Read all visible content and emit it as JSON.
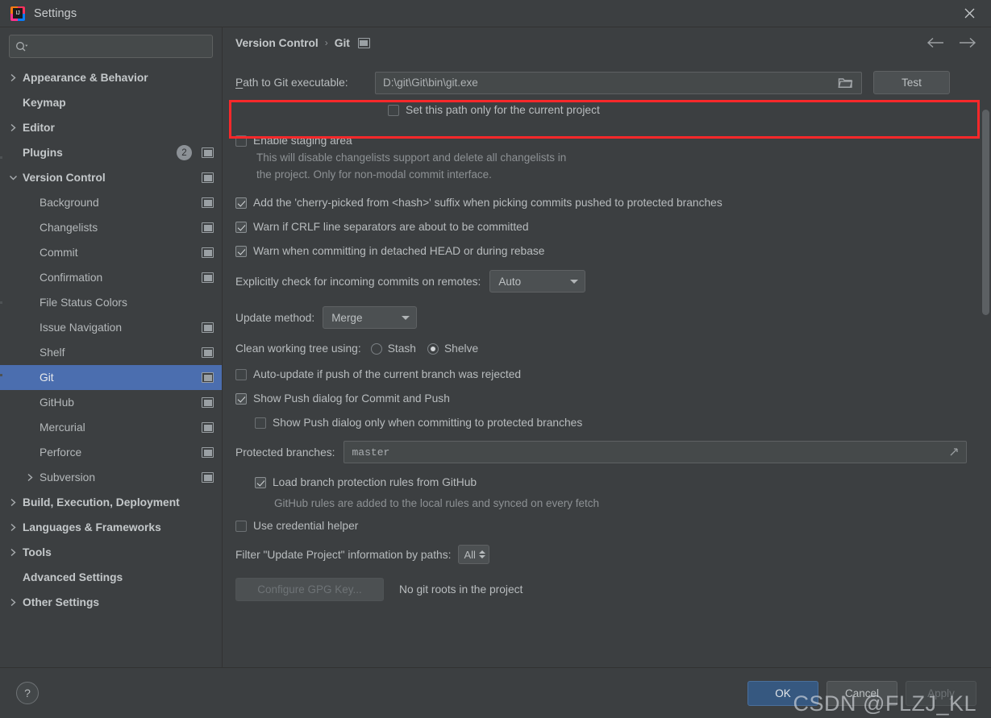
{
  "window": {
    "title": "Settings",
    "app_icon": "intellij-idea-icon",
    "close_icon": "close-icon"
  },
  "sidebar": {
    "search": {
      "placeholder": "",
      "value": "",
      "icon": "search-icon"
    },
    "items": [
      {
        "label": "Appearance & Behavior",
        "level": 0,
        "arrow": "right",
        "bold": true,
        "badge": "",
        "mod": false
      },
      {
        "label": "Keymap",
        "level": 0,
        "arrow": "none",
        "bold": true,
        "badge": "",
        "mod": false
      },
      {
        "label": "Editor",
        "level": 0,
        "arrow": "right",
        "bold": true,
        "badge": "",
        "mod": false
      },
      {
        "label": "Plugins",
        "level": 0,
        "arrow": "none",
        "bold": true,
        "badge": "2",
        "mod": true
      },
      {
        "label": "Version Control",
        "level": 0,
        "arrow": "down",
        "bold": true,
        "badge": "",
        "mod": true
      },
      {
        "label": "Background",
        "level": 1,
        "arrow": "none",
        "bold": false,
        "badge": "",
        "mod": true
      },
      {
        "label": "Changelists",
        "level": 1,
        "arrow": "none",
        "bold": false,
        "badge": "",
        "mod": true
      },
      {
        "label": "Commit",
        "level": 1,
        "arrow": "none",
        "bold": false,
        "badge": "",
        "mod": true
      },
      {
        "label": "Confirmation",
        "level": 1,
        "arrow": "none",
        "bold": false,
        "badge": "",
        "mod": true
      },
      {
        "label": "File Status Colors",
        "level": 1,
        "arrow": "none",
        "bold": false,
        "badge": "",
        "mod": false
      },
      {
        "label": "Issue Navigation",
        "level": 1,
        "arrow": "none",
        "bold": false,
        "badge": "",
        "mod": true
      },
      {
        "label": "Shelf",
        "level": 1,
        "arrow": "none",
        "bold": false,
        "badge": "",
        "mod": true
      },
      {
        "label": "Git",
        "level": 1,
        "arrow": "none",
        "bold": false,
        "badge": "",
        "mod": true,
        "selected": true
      },
      {
        "label": "GitHub",
        "level": 1,
        "arrow": "none",
        "bold": false,
        "badge": "",
        "mod": true
      },
      {
        "label": "Mercurial",
        "level": 1,
        "arrow": "none",
        "bold": false,
        "badge": "",
        "mod": true
      },
      {
        "label": "Perforce",
        "level": 1,
        "arrow": "none",
        "bold": false,
        "badge": "",
        "mod": true
      },
      {
        "label": "Subversion",
        "level": 1,
        "arrow": "right",
        "bold": false,
        "badge": "",
        "mod": true
      },
      {
        "label": "Build, Execution, Deployment",
        "level": 0,
        "arrow": "right",
        "bold": true,
        "badge": "",
        "mod": false
      },
      {
        "label": "Languages & Frameworks",
        "level": 0,
        "arrow": "right",
        "bold": true,
        "badge": "",
        "mod": false
      },
      {
        "label": "Tools",
        "level": 0,
        "arrow": "right",
        "bold": true,
        "badge": "",
        "mod": false
      },
      {
        "label": "Advanced Settings",
        "level": 0,
        "arrow": "none",
        "bold": true,
        "badge": "",
        "mod": false
      },
      {
        "label": "Other Settings",
        "level": 0,
        "arrow": "right",
        "bold": true,
        "badge": "",
        "mod": false
      }
    ]
  },
  "main": {
    "breadcrumb": {
      "parent": "Version Control",
      "separator": "›",
      "current": "Git"
    },
    "nav": {
      "back_icon": "arrow-left-icon",
      "forward_icon": "arrow-right-icon"
    },
    "git_path": {
      "label": "Path to Git executable:",
      "label_mnemonic": "P",
      "label_rest": "ath to Git executable:",
      "value": "D:\\git\\Git\\bin\\git.exe",
      "browse_icon": "folder-icon",
      "test_button": "Test",
      "highlight_color": "#f9282a"
    },
    "set_path_project": {
      "label": "Set this path only for the current project",
      "checked": false
    },
    "enable_staging": {
      "label": "Enable staging area",
      "checked": false,
      "help_line1": "This will disable changelists support and delete all changelists in",
      "help_line2": "the project. Only for non-modal commit interface."
    },
    "cherry_picked": {
      "label": "Add the 'cherry-picked from <hash>' suffix when picking commits pushed to protected branches",
      "checked": true
    },
    "warn_crlf": {
      "label": "Warn if CRLF line separators are about to be committed",
      "checked": true
    },
    "warn_detached": {
      "label": "Warn when committing in detached HEAD or during rebase",
      "checked": true
    },
    "incoming_commits": {
      "label": "Explicitly check for incoming commits on remotes:",
      "value": "Auto"
    },
    "update_method": {
      "label": "Update method:",
      "value": "Merge"
    },
    "clean_working_tree": {
      "label": "Clean working tree using:",
      "options": [
        "Stash",
        "Shelve"
      ],
      "selected": "Shelve"
    },
    "auto_update": {
      "label": "Auto-update if push of the current branch was rejected",
      "checked": false
    },
    "show_push_dialog": {
      "label": "Show Push dialog for Commit and Push",
      "checked": true
    },
    "show_push_protected": {
      "label": "Show Push dialog only when committing to protected branches",
      "checked": false
    },
    "protected_branches": {
      "label": "Protected branches:",
      "value": "master",
      "expand_icon": "expand-icon"
    },
    "load_branch_rules": {
      "label": "Load branch protection rules from GitHub",
      "checked": true,
      "help": "GitHub rules are added to the local rules and synced on every fetch"
    },
    "credential_helper": {
      "label": "Use credential helper",
      "checked": false
    },
    "filter_paths": {
      "label": "Filter \"Update Project\" information by paths:",
      "value": "All"
    },
    "gpg": {
      "button": "Configure GPG Key...",
      "status": "No git roots in the project"
    }
  },
  "footer": {
    "help_icon": "?",
    "ok": "OK",
    "cancel": "Cancel",
    "apply": "Apply"
  },
  "watermark": "CSDN @FLZJ_KL"
}
